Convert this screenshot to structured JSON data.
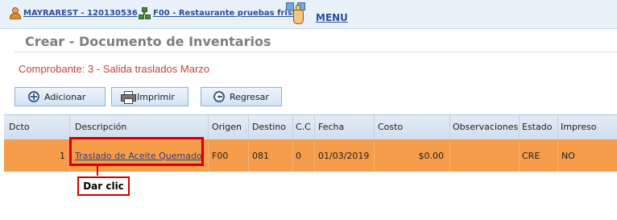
{
  "topbar": {
    "user_label": "MAYRAREST - 120130536",
    "restaurant_label": "F00 - Restaurante pruebas frisby",
    "menu_label": "MENU"
  },
  "header": {
    "title": "Crear - Documento de Inventarios",
    "comprobante": "Comprobante: 3 - Salida traslados Marzo"
  },
  "toolbar": {
    "add_label": "Adicionar",
    "print_label": "Imprimir",
    "back_label": "Regresar"
  },
  "grid": {
    "columns": [
      "Dcto",
      "Descripción",
      "Origen",
      "Destino",
      "C.C",
      "Fecha",
      "Costo",
      "Observaciones",
      "Estado",
      "Impreso"
    ],
    "rows": [
      {
        "dcto": "1",
        "descripcion": "Traslado de Aceite Quemado",
        "origen": "F00",
        "destino": "081",
        "cc": "0",
        "fecha": "01/03/2019",
        "costo": "$0.00",
        "observaciones": "",
        "estado": "CRE",
        "impreso": "NO"
      }
    ]
  },
  "annotation": {
    "callout_label": "Dar clic"
  },
  "colors": {
    "row_highlight": "#f59d4b",
    "annotation_red": "#d40000",
    "comprobante_red": "#c0443a",
    "link_blue": "#2b4e9e"
  }
}
